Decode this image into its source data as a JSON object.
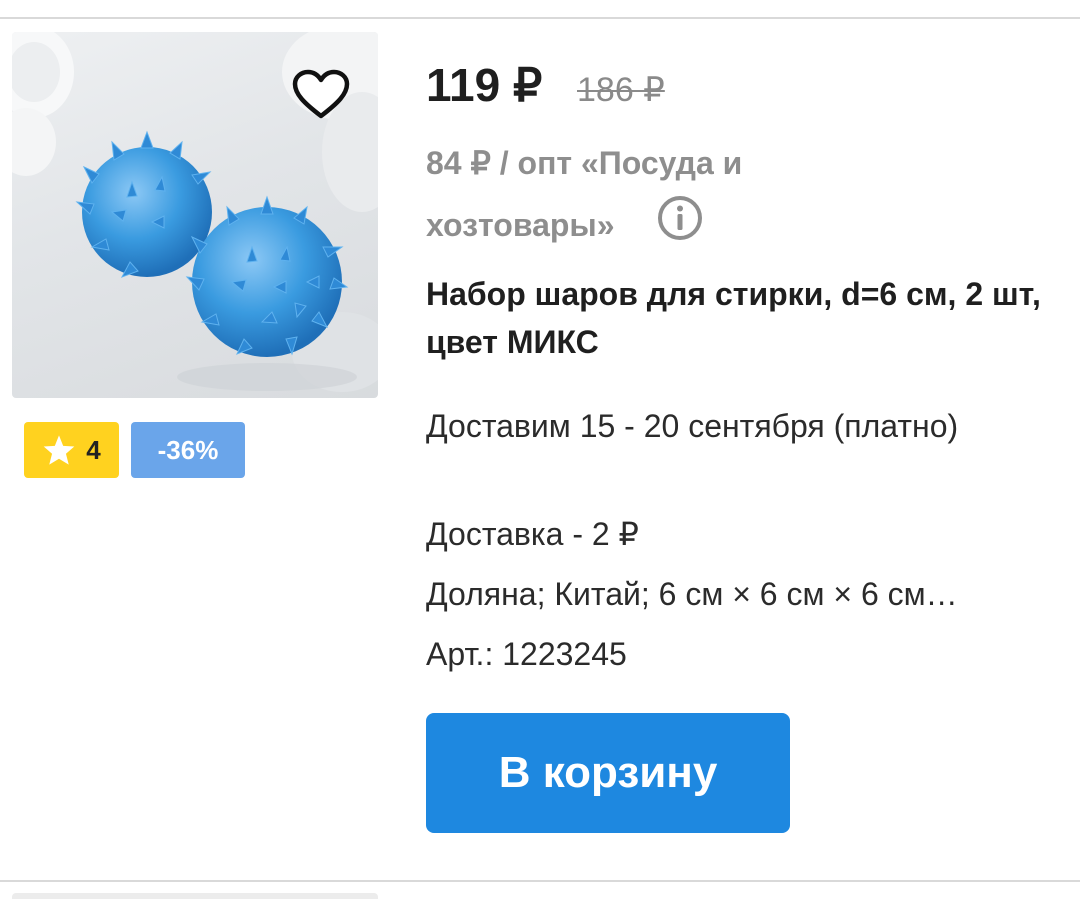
{
  "product": {
    "price": "119 ₽",
    "old_price": "186 ₽",
    "wholesale": "84 ₽ / опт «Посуда и хозтовары»",
    "title": "Набор шаров для стирки, d=6 см, 2 шт, цвет МИКС",
    "delivery_date": "Доставим 15 - 20 сентября (платно)",
    "delivery_cost": "Доставка - 2 ₽",
    "properties": "Доляна; Китай; 6 см × 6 см × 6 см…",
    "sku": "Арт.: 1223245",
    "rating": "4",
    "discount": "-36%"
  },
  "actions": {
    "add_to_cart": "В корзину"
  },
  "icons": {
    "favorite": "heart-outline-icon",
    "info": "info-circle-icon",
    "rating": "star-icon"
  },
  "colors": {
    "accent": "#1e88e0",
    "rating_badge": "#ffd21f",
    "discount_badge": "#6aa5ea",
    "ball": "#3a9be0"
  }
}
